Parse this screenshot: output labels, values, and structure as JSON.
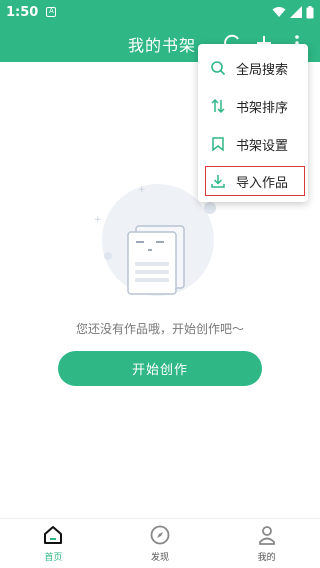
{
  "status_bar": {
    "time": "1:50",
    "notification_icon": "A"
  },
  "app_bar": {
    "title": "我的书架",
    "icons": [
      "refresh-icon",
      "plus-icon",
      "more-vert-icon"
    ]
  },
  "menu": {
    "items": [
      {
        "label": "全局搜索",
        "icon": "search-icon"
      },
      {
        "label": "书架排序",
        "icon": "sort-icon"
      },
      {
        "label": "书架设置",
        "icon": "bookmark-icon"
      },
      {
        "label": "导入作品",
        "icon": "download-icon",
        "highlighted": true
      }
    ]
  },
  "empty_state": {
    "message": "您还没有作品哦，开始创作吧～",
    "button_label": "开始创作"
  },
  "tab_bar": {
    "items": [
      {
        "label": "首页",
        "icon": "home-icon",
        "active": true
      },
      {
        "label": "发现",
        "icon": "compass-icon",
        "active": false
      },
      {
        "label": "我的",
        "icon": "person-icon",
        "active": false
      }
    ]
  },
  "colors": {
    "primary": "#2fb786",
    "highlight_border": "#d83a3a"
  }
}
